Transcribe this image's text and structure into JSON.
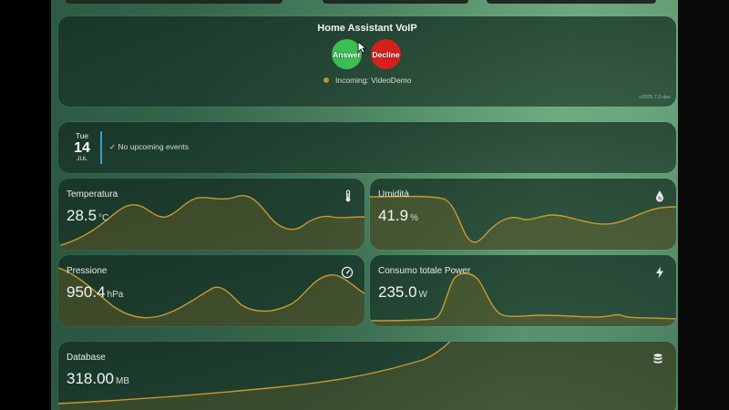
{
  "voip": {
    "title": "Home Assistant VoIP",
    "answer_label": "Answer",
    "decline_label": "Decline",
    "status": "Incoming: VideoDemo",
    "version": "v2025.7.2-dev"
  },
  "calendar": {
    "weekday": "Tue",
    "day": "14",
    "month": "JUL",
    "message": "✓ No upcoming events"
  },
  "sensors": [
    {
      "title": "Temperatura",
      "value": "28.5",
      "unit": "°C",
      "icon": "thermometer-icon"
    },
    {
      "title": "Umidità",
      "value": "41.9",
      "unit": "%",
      "icon": "water-drop-icon"
    },
    {
      "title": "Pressione",
      "value": "950.4",
      "unit": "hPa",
      "icon": "gauge-icon"
    },
    {
      "title": "Consumo totale Power",
      "value": "235.0",
      "unit": "W",
      "icon": "lightning-icon"
    },
    {
      "title": "Database",
      "value": "318.00",
      "unit": "MB",
      "icon": "database-icon"
    }
  ],
  "colors": {
    "accent_line": "#c99a2e",
    "answer": "#3cbf52",
    "decline": "#d71f1f",
    "status_dot": "#b8962a",
    "calendar_bar": "#3b9bd4"
  }
}
